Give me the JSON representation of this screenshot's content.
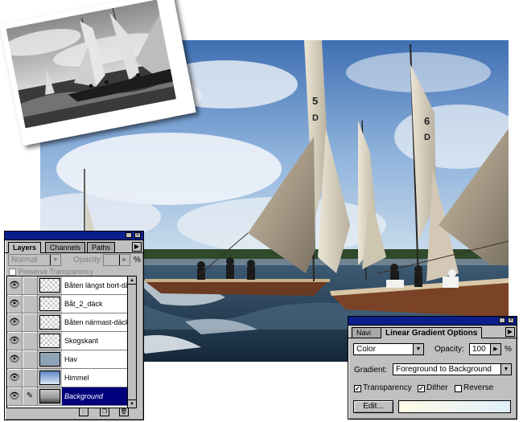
{
  "layers_palette": {
    "tabs": [
      {
        "label": "Layers",
        "active": true
      },
      {
        "label": "Channels",
        "active": false
      },
      {
        "label": "Paths",
        "active": false
      }
    ],
    "blend_mode": "Normal",
    "opacity_label": "Opacity:",
    "opacity_unit": "%",
    "preserve_transparency_label": "Preserve Transparency",
    "layers": [
      {
        "name": "Båten längst bort-däck",
        "visible": true,
        "selected": false
      },
      {
        "name": "Båt_2_däck",
        "visible": true,
        "selected": false
      },
      {
        "name": "Båten närmast-däck",
        "visible": true,
        "selected": false
      },
      {
        "name": "Skogskant",
        "visible": true,
        "selected": false
      },
      {
        "name": "Hav",
        "visible": true,
        "selected": false
      },
      {
        "name": "Himmel",
        "visible": true,
        "selected": false
      },
      {
        "name": "Background",
        "visible": true,
        "selected": true
      }
    ]
  },
  "gradient_palette": {
    "tabs": [
      {
        "label": "Navi",
        "active": false
      },
      {
        "label": "Linear Gradient Options",
        "active": true
      }
    ],
    "mode": "Color",
    "opacity_label": "Opacity:",
    "opacity_value": "100",
    "opacity_unit": "%",
    "gradient_label": "Gradient:",
    "gradient_value": "Foreground to Background",
    "transparency_label": "Transparency",
    "dither_label": "Dither",
    "reverse_label": "Reverse",
    "transparency_checked": true,
    "dither_checked": true,
    "reverse_checked": false,
    "edit_label": "Edit..."
  },
  "icons": {
    "eye": "eye-icon",
    "brush": "paintbrush-icon",
    "menu": "palette-menu-arrow-icon"
  },
  "colors": {
    "title_bar": "#0a1e8c",
    "selection": "#00007c",
    "panel": "#c0c0c0"
  }
}
